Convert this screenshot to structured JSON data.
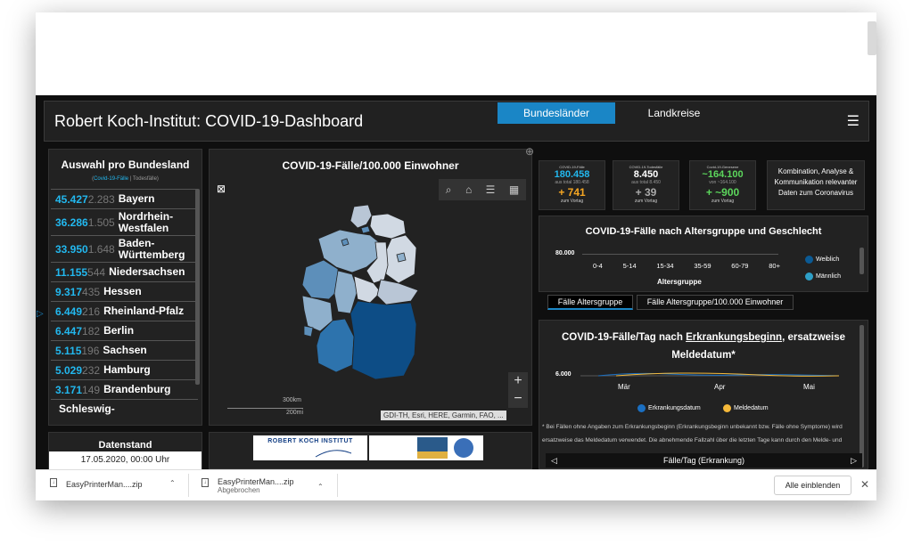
{
  "header": {
    "title": "Robert Koch-Institut: COVID-19-Dashboard",
    "tabs": [
      {
        "label": "Bundesländer",
        "active": true
      },
      {
        "label": "Landkreise",
        "active": false
      }
    ],
    "menu_icon": "hamburger-icon"
  },
  "left_panel": {
    "title": "Auswahl pro Bundesland",
    "subtitle_cases": "Covid-19-Fälle",
    "subtitle_sep": " | ",
    "subtitle_deaths": "Todesfälle",
    "states": [
      {
        "cases": "45.427",
        "deaths": "2.283",
        "name": "Bayern"
      },
      {
        "cases": "36.286",
        "deaths": "1.505",
        "name": "Nordrhein-Westfalen"
      },
      {
        "cases": "33.950",
        "deaths": "1.648",
        "name": "Baden-Württemberg"
      },
      {
        "cases": "11.155",
        "deaths": "544",
        "name": "Niedersachsen"
      },
      {
        "cases": "9.317",
        "deaths": "435",
        "name": "Hessen"
      },
      {
        "cases": "6.449",
        "deaths": "216",
        "name": "Rheinland-Pfalz"
      },
      {
        "cases": "6.447",
        "deaths": "182",
        "name": "Berlin"
      },
      {
        "cases": "5.115",
        "deaths": "196",
        "name": "Sachsen"
      },
      {
        "cases": "5.029",
        "deaths": "232",
        "name": "Hamburg"
      },
      {
        "cases": "3.171",
        "deaths": "149",
        "name": "Brandenburg"
      },
      {
        "cases": "",
        "deaths": "",
        "name": "Schleswig-"
      }
    ]
  },
  "datenstand": {
    "label": "Datenstand",
    "value": "17.05.2020, 00:00 Uhr"
  },
  "map": {
    "title": "COVID-19-Fälle/100.000 Einwohner",
    "scale_km": "300km",
    "scale_mi": "200mi",
    "attribution": "GDI-TH, Esri, HERE, Garmin, FAO, ...",
    "zoom_in": "+",
    "zoom_out": "−",
    "tool_icons": [
      "search-icon",
      "home-icon",
      "list-icon",
      "qr-icon"
    ]
  },
  "stats": [
    {
      "label": "COVID-19-Fälle",
      "value": "180.458",
      "total": "aus total 180.458",
      "delta": "+ 741",
      "delta_label": "zum Vortag",
      "color": "#22b8ef",
      "delta_color": "#f5a623"
    },
    {
      "label": "COVID-19-Todesfälle",
      "value": "8.450",
      "total": "aus total 8.450",
      "delta": "+ 39",
      "delta_label": "zum Vortag",
      "color": "#ffffff",
      "delta_color": "#aaaaaa"
    },
    {
      "label": "Covid-19-Genesene",
      "value": "~164.100",
      "total": "von ~164.100",
      "delta": "+ ~900",
      "delta_label": "zum Vortag",
      "color": "#5cd65c",
      "delta_color": "#5cd65c"
    }
  ],
  "info_box": "Kombination, Analyse & Kommunikation relevanter Daten zum Coronavirus",
  "age_chart": {
    "title": "COVID-19-Fälle nach Altersgruppe und Geschlecht",
    "y_label": "80.000",
    "categories": [
      "0-4",
      "5-14",
      "15-34",
      "35-59",
      "60-79",
      "80+"
    ],
    "x_label": "Altersgruppe",
    "legend": [
      {
        "name": "Weiblich",
        "color": "#0b5a94"
      },
      {
        "name": "Männlich",
        "color": "#2e9fc7"
      }
    ],
    "tabs": [
      "Fälle Altersgruppe",
      "Fälle Altersgruppe/100.000 Einwohner"
    ]
  },
  "day_chart": {
    "title_part1": "COVID-19-Fälle/Tag nach ",
    "title_link": "Erkrankungsbeginn",
    "title_part2": ", ersatzweise",
    "title_line2": "Meldedatum*",
    "y_label": "6.000",
    "months": [
      "Mär",
      "Apr",
      "Mai"
    ],
    "legend": [
      {
        "name": "Erkrankungsdatum",
        "color": "#1a6fc2"
      },
      {
        "name": "Meldedatum",
        "color": "#f5b93a"
      }
    ],
    "note": "* Bei Fällen ohne Angaben zum Erkrankungsbeginn (Erkrankungsbeginn unbekannt bzw. Fälle ohne Symptome) wird ersatzweise das Meldedatum verwendet. Die abnehmende Fallzahl über die letzten Tage kann durch den Melde- und Übermittlungsverzug bedingt sein.",
    "footer": "Fälle/Tag (Erkrankung)"
  },
  "logos": {
    "rki": "ROBERT KOCH INSTITUT"
  },
  "downloads": {
    "items": [
      {
        "name": "EasyPrinterMan....zip",
        "status": ""
      },
      {
        "name": "EasyPrinterMan....zip",
        "status": "Abgebrochen"
      }
    ],
    "show_all": "Alle einblenden"
  }
}
